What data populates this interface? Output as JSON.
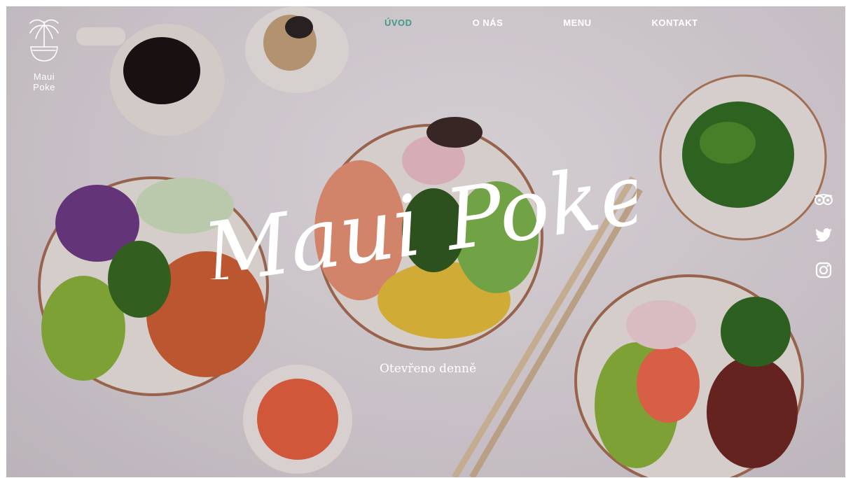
{
  "brand": {
    "name": "Maui Poke",
    "hero_title": "Maui Poke",
    "subtitle": "Otevřeno denně"
  },
  "nav": [
    {
      "label": "ÚVOD",
      "active": true
    },
    {
      "label": "O NÁS",
      "active": false
    },
    {
      "label": "MENU",
      "active": false
    },
    {
      "label": "KONTAKT",
      "active": false
    }
  ],
  "social": [
    {
      "icon": "tripadvisor-icon"
    },
    {
      "icon": "twitter-icon"
    },
    {
      "icon": "instagram-icon"
    }
  ],
  "colors": {
    "active_nav": "#3f9b89",
    "text": "#ffffff"
  }
}
